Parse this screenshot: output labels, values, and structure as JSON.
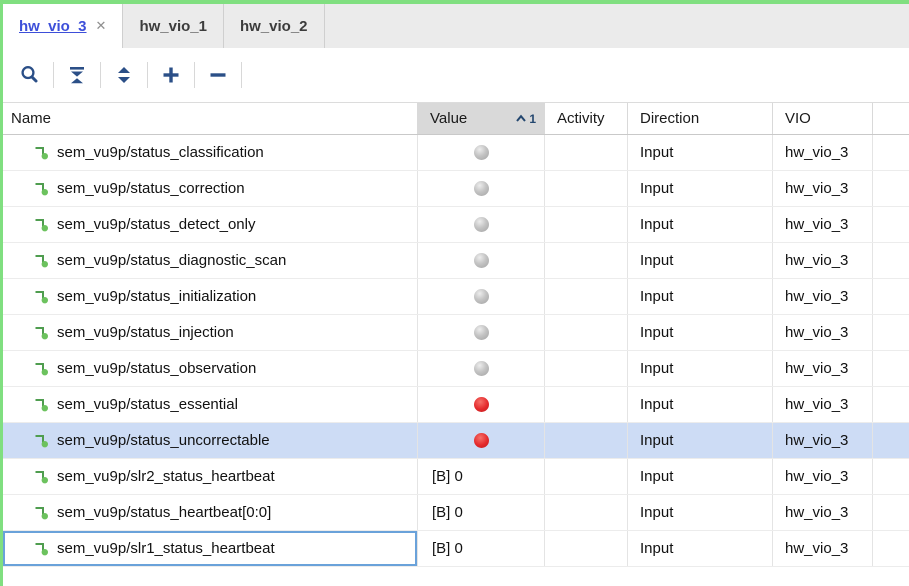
{
  "tabs": [
    {
      "label": "hw_vio_3",
      "active": true,
      "close_glyph": "✕"
    },
    {
      "label": "hw_vio_1",
      "active": false
    },
    {
      "label": "hw_vio_2",
      "active": false
    }
  ],
  "toolbar": {
    "buttons": [
      {
        "name": "search"
      },
      {
        "name": "collapse-all"
      },
      {
        "name": "expand-all"
      },
      {
        "name": "add-probes"
      },
      {
        "name": "remove-probes"
      }
    ]
  },
  "table": {
    "columns": [
      {
        "label": "Name"
      },
      {
        "label": "Value",
        "sorted": true,
        "sort_order": "1"
      },
      {
        "label": "Activity"
      },
      {
        "label": "Direction"
      },
      {
        "label": "VIO"
      }
    ],
    "rows": [
      {
        "name": "sem_vu9p/status_classification",
        "value": "",
        "led": "gray",
        "activity": "",
        "direction": "Input",
        "vio": "hw_vio_3"
      },
      {
        "name": "sem_vu9p/status_correction",
        "value": "",
        "led": "gray",
        "activity": "",
        "direction": "Input",
        "vio": "hw_vio_3"
      },
      {
        "name": "sem_vu9p/status_detect_only",
        "value": "",
        "led": "gray",
        "activity": "",
        "direction": "Input",
        "vio": "hw_vio_3"
      },
      {
        "name": "sem_vu9p/status_diagnostic_scan",
        "value": "",
        "led": "gray",
        "activity": "",
        "direction": "Input",
        "vio": "hw_vio_3"
      },
      {
        "name": "sem_vu9p/status_initialization",
        "value": "",
        "led": "gray",
        "activity": "",
        "direction": "Input",
        "vio": "hw_vio_3"
      },
      {
        "name": "sem_vu9p/status_injection",
        "value": "",
        "led": "gray",
        "activity": "",
        "direction": "Input",
        "vio": "hw_vio_3"
      },
      {
        "name": "sem_vu9p/status_observation",
        "value": "",
        "led": "gray",
        "activity": "",
        "direction": "Input",
        "vio": "hw_vio_3"
      },
      {
        "name": "sem_vu9p/status_essential",
        "value": "",
        "led": "red",
        "activity": "",
        "direction": "Input",
        "vio": "hw_vio_3"
      },
      {
        "name": "sem_vu9p/status_uncorrectable",
        "value": "",
        "led": "red",
        "activity": "",
        "direction": "Input",
        "vio": "hw_vio_3",
        "selected": true
      },
      {
        "name": "sem_vu9p/slr2_status_heartbeat",
        "value": "[B] 0",
        "led": null,
        "activity": "",
        "direction": "Input",
        "vio": "hw_vio_3"
      },
      {
        "name": "sem_vu9p/status_heartbeat[0:0]",
        "value": "[B] 0",
        "led": null,
        "activity": "",
        "direction": "Input",
        "vio": "hw_vio_3"
      },
      {
        "name": "sem_vu9p/slr1_status_heartbeat",
        "value": "[B] 0",
        "led": null,
        "activity": "",
        "direction": "Input",
        "vio": "hw_vio_3",
        "focused": true
      }
    ]
  },
  "colors": {
    "frame_green": "#80df80",
    "icon_navy": "#2b4f87",
    "selected_row": "#cddcf5",
    "led_red": "#e42a2c",
    "led_gray": "#c4c4c4",
    "focus_border": "#6aa2da",
    "active_tab_text": "#3d4fd9"
  }
}
